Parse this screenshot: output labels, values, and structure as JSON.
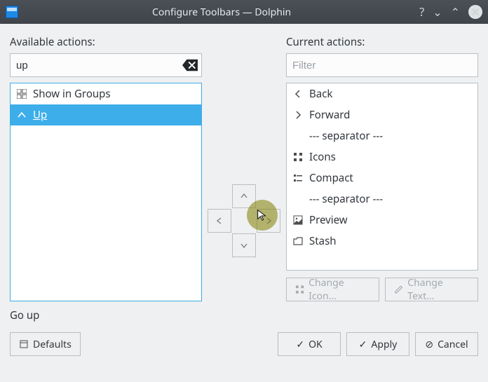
{
  "titlebar": {
    "title": "Configure Toolbars — Dolphin"
  },
  "available": {
    "heading": "Available actions:",
    "filter_value": "up",
    "items": [
      {
        "icon": "grid-icon",
        "label": "Show in Groups",
        "selected": false
      },
      {
        "icon": "chevron-up-icon",
        "label": "Up",
        "selected": true
      }
    ]
  },
  "current": {
    "heading": "Current actions:",
    "filter_placeholder": "Filter",
    "items": [
      {
        "icon": "chevron-left-icon",
        "label": "Back"
      },
      {
        "icon": "chevron-right-icon",
        "label": "Forward"
      },
      {
        "icon": "separator-icon",
        "label": "--- separator ---"
      },
      {
        "icon": "icons-view-icon",
        "label": "Icons"
      },
      {
        "icon": "compact-view-icon",
        "label": "Compact"
      },
      {
        "icon": "separator-icon",
        "label": "--- separator ---"
      },
      {
        "icon": "preview-icon",
        "label": "Preview"
      },
      {
        "icon": "stash-icon",
        "label": "Stash"
      }
    ]
  },
  "action_buttons": {
    "change_icon": "Change Icon...",
    "change_text": "Change Text..."
  },
  "status": "Go up",
  "footer": {
    "defaults": "Defaults",
    "ok": "OK",
    "apply": "Apply",
    "cancel": "Cancel"
  }
}
